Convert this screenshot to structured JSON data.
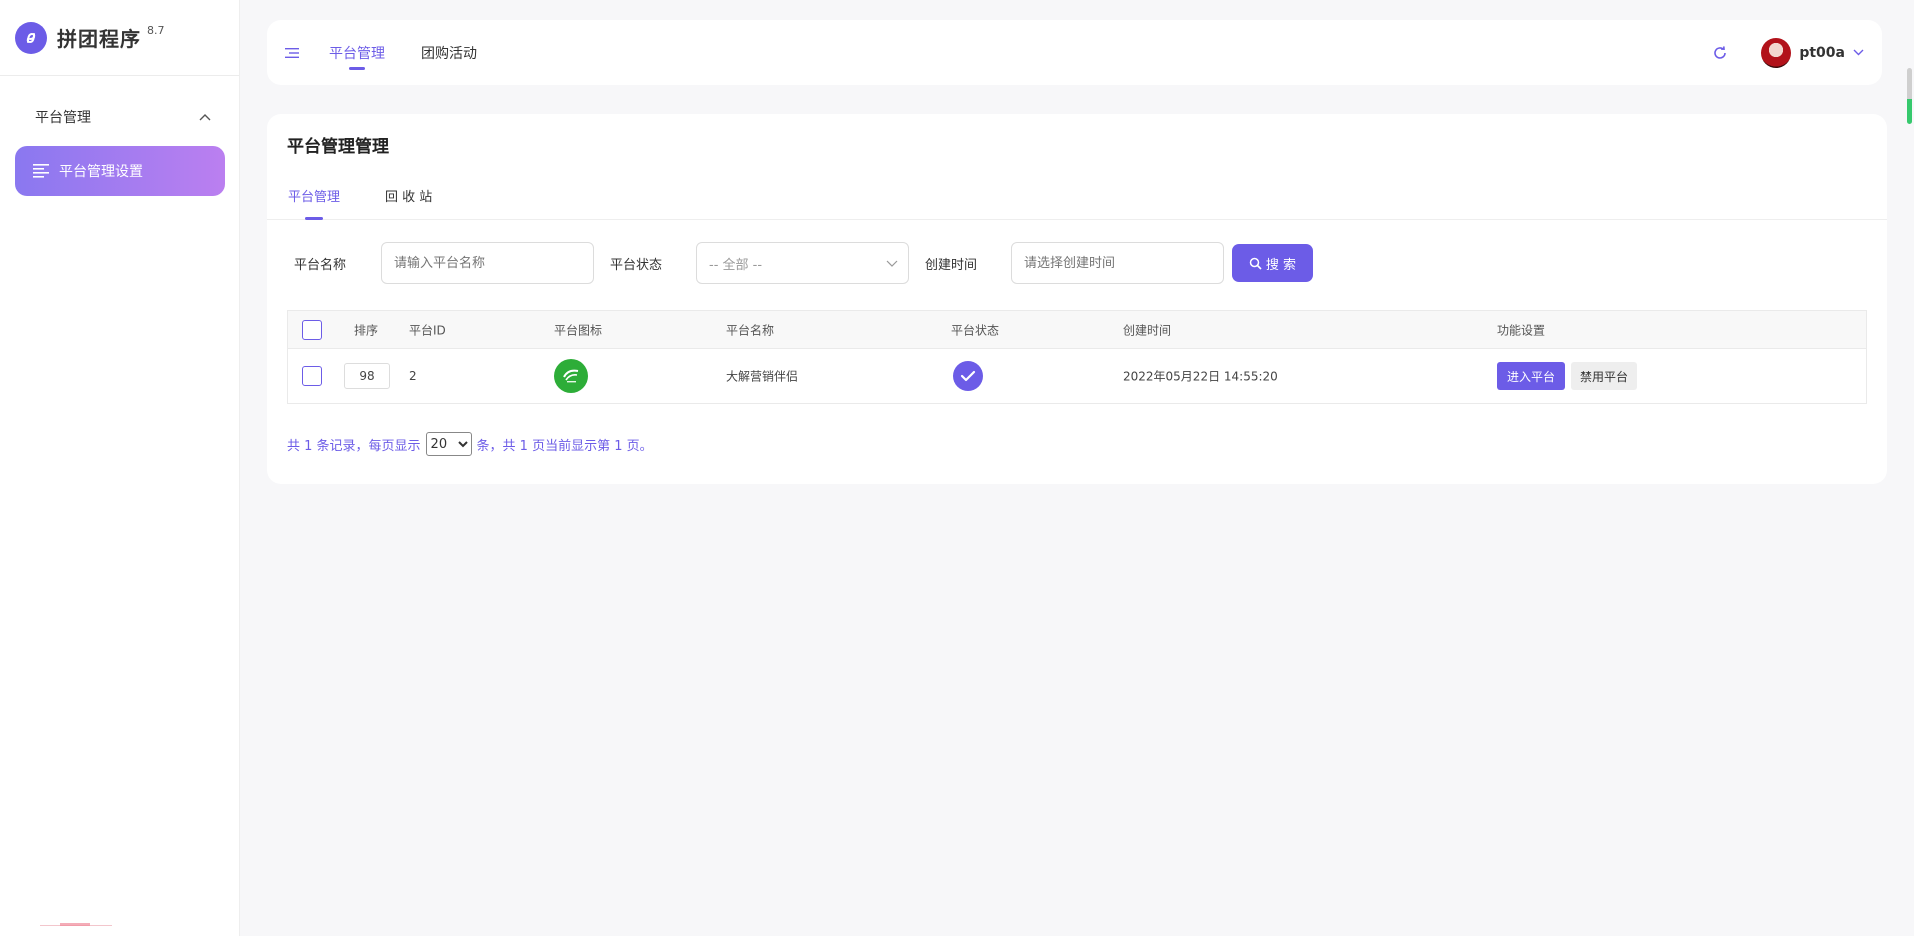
{
  "app": {
    "title": "拼团程序",
    "version": "8.7",
    "brand_color": "#6c5ce7"
  },
  "sidebar": {
    "group_label": "平台管理",
    "active_item": "平台管理设置"
  },
  "header": {
    "tabs": [
      {
        "label": "平台管理",
        "active": true
      },
      {
        "label": "团购活动",
        "active": false
      }
    ],
    "username": "pt00a"
  },
  "main": {
    "page_title": "平台管理管理",
    "tabs": [
      {
        "label": "平台管理",
        "active": true
      },
      {
        "label": "回 收 站",
        "active": false
      }
    ],
    "filters": {
      "name_label": "平台名称",
      "name_placeholder": "请输入平台名称",
      "status_label": "平台状态",
      "status_value": "-- 全部 --",
      "time_label": "创建时间",
      "time_placeholder": "请选择创建时间",
      "search_label": "搜 索"
    },
    "table": {
      "headers": [
        "排序",
        "平台ID",
        "平台图标",
        "平台名称",
        "平台状态",
        "创建时间",
        "功能设置"
      ],
      "rows": [
        {
          "sort": "98",
          "id": "2",
          "name": "大解营销伴侣",
          "created": "2022年05月22日 14:55:20",
          "status_icon": "check-circle-icon",
          "actions": [
            "进入平台",
            "禁用平台"
          ]
        }
      ]
    },
    "pager": {
      "prefix": "共 1 条记录，每页显示",
      "per_page": "20",
      "suffix": "条，共 1 页当前显示第 1 页。"
    }
  }
}
